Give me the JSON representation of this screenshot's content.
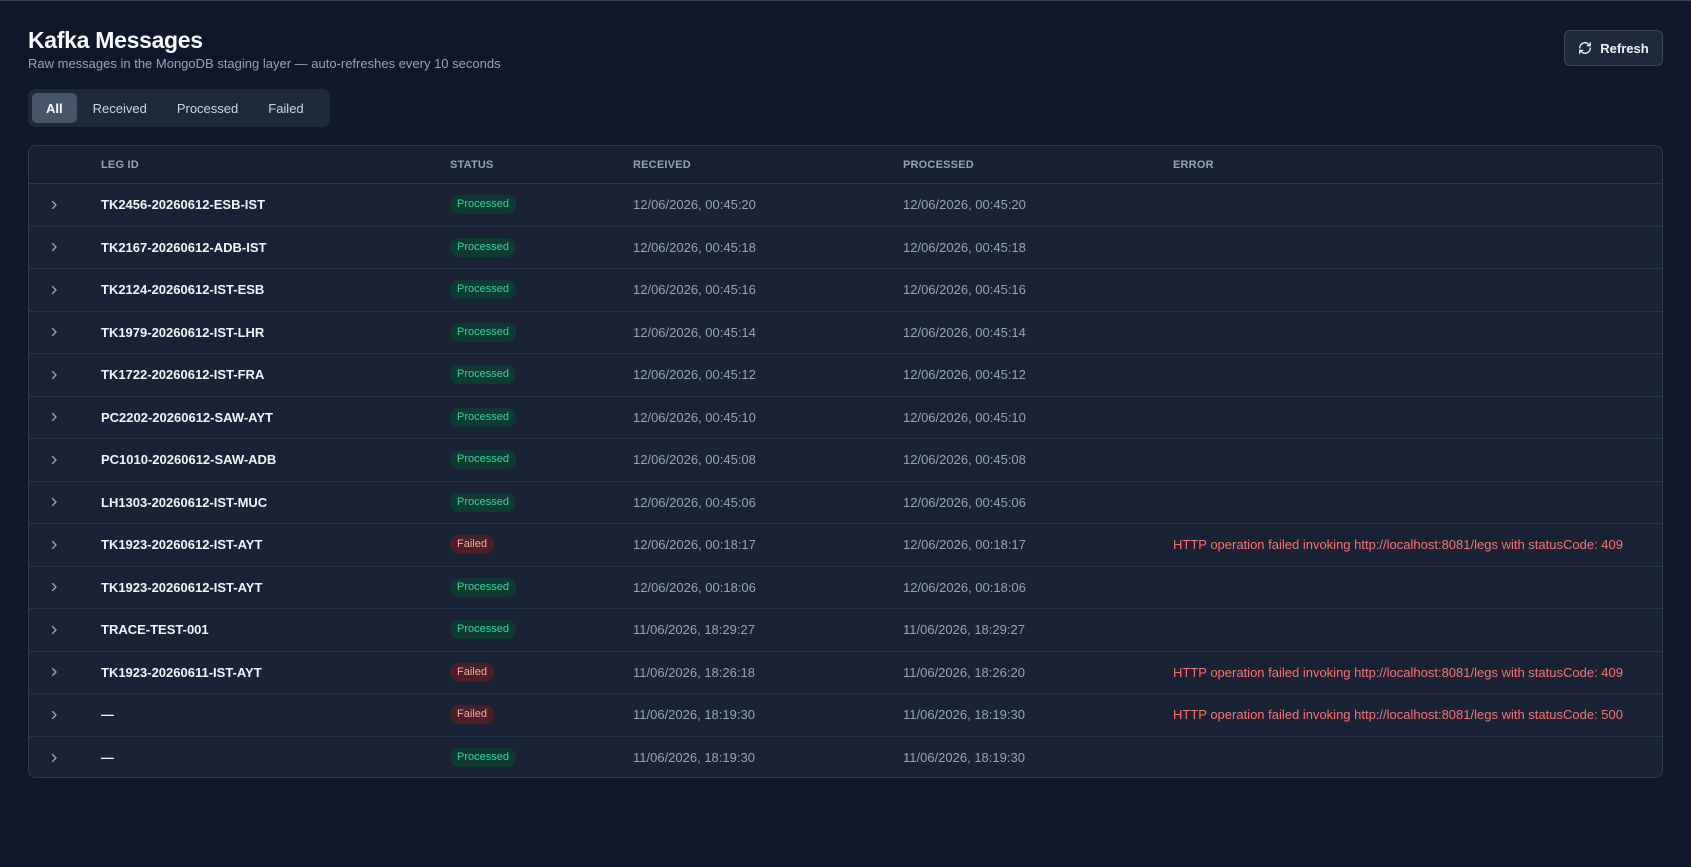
{
  "header": {
    "title": "Kafka Messages",
    "subtitle": "Raw messages in the MongoDB staging layer — auto-refreshes every 10 seconds",
    "refresh_label": "Refresh"
  },
  "tabs": [
    {
      "label": "All",
      "active": true
    },
    {
      "label": "Received",
      "active": false
    },
    {
      "label": "Processed",
      "active": false
    },
    {
      "label": "Failed",
      "active": false
    }
  ],
  "table": {
    "columns": [
      "LEG ID",
      "STATUS",
      "RECEIVED",
      "PROCESSED",
      "ERROR"
    ],
    "rows": [
      {
        "leg_id": "TK2456-20260612-ESB-IST",
        "status": "Processed",
        "received": "12/06/2026, 00:45:20",
        "processed": "12/06/2026, 00:45:20",
        "error": ""
      },
      {
        "leg_id": "TK2167-20260612-ADB-IST",
        "status": "Processed",
        "received": "12/06/2026, 00:45:18",
        "processed": "12/06/2026, 00:45:18",
        "error": ""
      },
      {
        "leg_id": "TK2124-20260612-IST-ESB",
        "status": "Processed",
        "received": "12/06/2026, 00:45:16",
        "processed": "12/06/2026, 00:45:16",
        "error": ""
      },
      {
        "leg_id": "TK1979-20260612-IST-LHR",
        "status": "Processed",
        "received": "12/06/2026, 00:45:14",
        "processed": "12/06/2026, 00:45:14",
        "error": ""
      },
      {
        "leg_id": "TK1722-20260612-IST-FRA",
        "status": "Processed",
        "received": "12/06/2026, 00:45:12",
        "processed": "12/06/2026, 00:45:12",
        "error": ""
      },
      {
        "leg_id": "PC2202-20260612-SAW-AYT",
        "status": "Processed",
        "received": "12/06/2026, 00:45:10",
        "processed": "12/06/2026, 00:45:10",
        "error": ""
      },
      {
        "leg_id": "PC1010-20260612-SAW-ADB",
        "status": "Processed",
        "received": "12/06/2026, 00:45:08",
        "processed": "12/06/2026, 00:45:08",
        "error": ""
      },
      {
        "leg_id": "LH1303-20260612-IST-MUC",
        "status": "Processed",
        "received": "12/06/2026, 00:45:06",
        "processed": "12/06/2026, 00:45:06",
        "error": ""
      },
      {
        "leg_id": "TK1923-20260612-IST-AYT",
        "status": "Failed",
        "received": "12/06/2026, 00:18:17",
        "processed": "12/06/2026, 00:18:17",
        "error": "HTTP operation failed invoking http://localhost:8081/legs with statusCode: 409"
      },
      {
        "leg_id": "TK1923-20260612-IST-AYT",
        "status": "Processed",
        "received": "12/06/2026, 00:18:06",
        "processed": "12/06/2026, 00:18:06",
        "error": ""
      },
      {
        "leg_id": "TRACE-TEST-001",
        "status": "Processed",
        "received": "11/06/2026, 18:29:27",
        "processed": "11/06/2026, 18:29:27",
        "error": ""
      },
      {
        "leg_id": "TK1923-20260611-IST-AYT",
        "status": "Failed",
        "received": "11/06/2026, 18:26:18",
        "processed": "11/06/2026, 18:26:20",
        "error": "HTTP operation failed invoking http://localhost:8081/legs with statusCode: 409"
      },
      {
        "leg_id": "—",
        "status": "Failed",
        "received": "11/06/2026, 18:19:30",
        "processed": "11/06/2026, 18:19:30",
        "error": "HTTP operation failed invoking http://localhost:8081/legs with statusCode: 500"
      },
      {
        "leg_id": "—",
        "status": "Processed",
        "received": "11/06/2026, 18:19:30",
        "processed": "11/06/2026, 18:19:30",
        "error": ""
      }
    ]
  },
  "colors": {
    "background": "#0f172a",
    "card": "#1a2335",
    "processed_badge_text": "#34d399",
    "failed_badge_text": "#fca5a5",
    "error_text": "#f87171"
  },
  "icons": {
    "refresh": "refresh-icon",
    "row_expand": "chevron-right-icon"
  }
}
